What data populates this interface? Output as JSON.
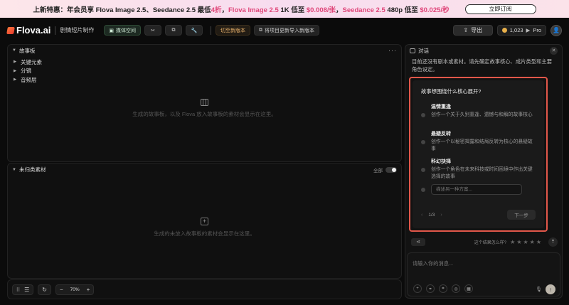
{
  "promo": {
    "lead": "上新特惠：年会员享 Flova Image 2.5、Seedance 2.5 最低",
    "discount": "4折",
    "sep": "，",
    "image_product": "Flova Image 2.5",
    "image_res": " 1K 低至 ",
    "image_price": "$0.008/张",
    "video_sep": "，",
    "video_product": "Seedance 2.5",
    "video_res": " 480p 低至 ",
    "video_price": "$0.025/秒",
    "cta": "立即订阅"
  },
  "toolbar": {
    "brand": "Flova.ai",
    "project_title": "剧情短片制作",
    "media_space": "媒体空间",
    "version_switch": "切至新版本",
    "import_new": "将项目更新导入新版本",
    "export": "导出",
    "credits": "1,023",
    "plan": "Pro"
  },
  "storyboard": {
    "title": "故事板",
    "items": [
      {
        "label": "关键元素"
      },
      {
        "label": "分镜"
      },
      {
        "label": "音频层"
      }
    ],
    "empty_text": "生成的故事板，以及 Flova 放入故事板的素材会显示在这里。"
  },
  "unsorted": {
    "title": "未归类素材",
    "toggle_label": "全部",
    "empty_text": "生成的未放入故事板的素材会显示在这里。"
  },
  "bottom_bar": {
    "zoom": "70%"
  },
  "chat": {
    "title": "对话",
    "intro": "目前还没有剧本或素材。请先确定故事核心、成片类型和主要角色设定。",
    "question": "故事想围绕什么核心展开?",
    "options": [
      {
        "title": "温情重逢",
        "desc": "创作一个关于久别重逢、遗憾与和解的故事核心"
      },
      {
        "title": "悬疑反转",
        "desc": "创作一个以秘密揭露和结局反转为核心的悬疑故事"
      },
      {
        "title": "科幻抉择",
        "desc": "创作一个角色在未来科技或时间困境中作出关键选择的故事"
      }
    ],
    "custom_placeholder": "描述另一种方案...",
    "pager": "1/3",
    "next": "下一步",
    "feedback_label": "这个结果怎么样?",
    "rating": {
      "max": 5,
      "value": 0
    },
    "input_placeholder": "请输入你的消息..."
  }
}
